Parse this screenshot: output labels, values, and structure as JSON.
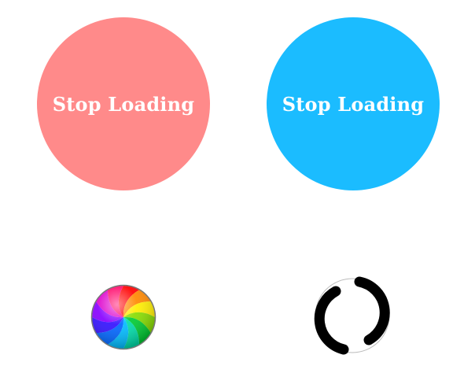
{
  "buttons": {
    "left": {
      "label": "Stop Loading",
      "color": "#ff8a8a"
    },
    "right": {
      "label": "Stop Loading",
      "color": "#1bbcff"
    }
  },
  "spinners": {
    "rainbow": {
      "icon": "rainbow-spinner-icon",
      "colors": [
        "#ff0000",
        "#ff8800",
        "#ffee00",
        "#88dd00",
        "#00cc33",
        "#00ddaa",
        "#00bbff",
        "#0066ff",
        "#3311ff",
        "#8800ff",
        "#dd00cc",
        "#ff0066"
      ]
    },
    "bw": {
      "icon": "black-ring-spinner-icon",
      "color": "#000000"
    }
  }
}
